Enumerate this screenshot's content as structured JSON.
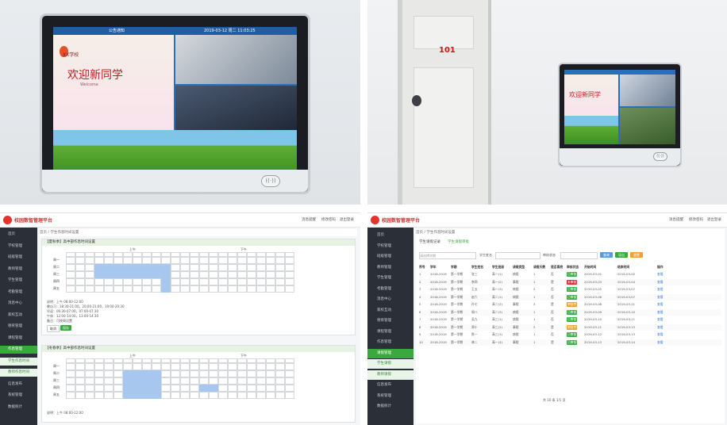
{
  "panel1": {
    "topbar_left": "公告通知",
    "topbar_time": "2019-03-12 周二 11:03:25",
    "greeting_school": "XX学校",
    "greeting_main": "欢迎新同学",
    "greeting_sub": "Welcome",
    "nfc_label": "((·))"
  },
  "panel2": {
    "door_number": "101",
    "screen_title": "欢迎新同学"
  },
  "panel3": {
    "brand": "校园数智管理平台",
    "header_right": [
      "消息提醒",
      "修改密码",
      "退出登录"
    ],
    "breadcrumb": "首页 / 学生作息时间设置",
    "card1_title": "【夏秋季】高中部作息时间设置",
    "card2_title": "【冬春季】高中部作息时间设置",
    "section_am": "上午",
    "section_pm": "下午",
    "days": [
      "周一",
      "周二",
      "周三",
      "周四",
      "周五"
    ],
    "save_btn": "保存",
    "cancel_btn": "取消",
    "desc_lines": [
      "说明：上午 08:00-12:00",
      "晚自习：18:30-21:00，20:00-21:00，19:00-20:30",
      "早读：06:30-07:00，07:00-07:30",
      "午休：12:00-14:00，13:00-14:30",
      "备注：可按周设置"
    ],
    "menu": [
      "首页",
      "学校管理",
      "班级管理",
      "教师管理",
      "学生管理",
      "考勤管理",
      "消息中心",
      "家校互动",
      "德育管理",
      "课程管理",
      "作息管理",
      "学生作息时间",
      "教师作息时间",
      "信息发布",
      "系统管理",
      "数据统计"
    ]
  },
  "panel4": {
    "brand": "校园数智管理平台",
    "tabs": [
      "学生请假记录",
      "学生请假审批"
    ],
    "filter_labels": [
      "请选择学期",
      "学生姓名",
      "审核状态"
    ],
    "buttons": [
      "查询",
      "导出",
      "重置"
    ],
    "columns": [
      "序号",
      "学年",
      "学期",
      "学生姓名",
      "学生班级",
      "请假类型",
      "请假天数",
      "是否离校",
      "审核状态",
      "开始时间",
      "结束时间",
      "操作"
    ],
    "rows": [
      [
        "1",
        "2018-2019",
        "第一学期",
        "张三",
        "高一(1)",
        "病假",
        "1",
        "否",
        "已审核",
        "2019-03-01",
        "2019-03-02",
        "查看"
      ],
      [
        "2",
        "2018-2019",
        "第一学期",
        "李四",
        "高一(2)",
        "事假",
        "1",
        "是",
        "未审核",
        "2019-03-03",
        "2019-03-04",
        "查看"
      ],
      [
        "3",
        "2018-2019",
        "第一学期",
        "王五",
        "高一(3)",
        "病假",
        "2",
        "否",
        "已审核",
        "2019-03-05",
        "2019-03-07",
        "查看"
      ],
      [
        "4",
        "2018-2019",
        "第一学期",
        "赵六",
        "高二(1)",
        "病假",
        "1",
        "否",
        "已审核",
        "2019-03-06",
        "2019-03-07",
        "查看"
      ],
      [
        "5",
        "2018-2019",
        "第一学期",
        "孙七",
        "高二(2)",
        "事假",
        "3",
        "是",
        "审核中",
        "2019-03-08",
        "2019-03-11",
        "查看"
      ],
      [
        "6",
        "2018-2019",
        "第一学期",
        "周八",
        "高二(3)",
        "病假",
        "1",
        "否",
        "已审核",
        "2019-03-09",
        "2019-03-10",
        "查看"
      ],
      [
        "7",
        "2018-2019",
        "第一学期",
        "吴九",
        "高三(1)",
        "病假",
        "1",
        "否",
        "已审核",
        "2019-03-10",
        "2019-03-11",
        "查看"
      ],
      [
        "8",
        "2018-2019",
        "第一学期",
        "郑十",
        "高三(2)",
        "事假",
        "2",
        "是",
        "审核中",
        "2019-03-11",
        "2019-03-13",
        "查看"
      ],
      [
        "9",
        "2018-2019",
        "第一学期",
        "陈一",
        "高三(3)",
        "病假",
        "1",
        "否",
        "已审核",
        "2019-03-12",
        "2019-03-13",
        "查看"
      ],
      [
        "10",
        "2018-2019",
        "第一学期",
        "林二",
        "高一(4)",
        "事假",
        "1",
        "是",
        "已审核",
        "2019-03-13",
        "2019-03-14",
        "查看"
      ]
    ],
    "pager": "共 10 条  1/1 页",
    "menu": [
      "首页",
      "学校管理",
      "班级管理",
      "教师管理",
      "学生管理",
      "考勤管理",
      "消息中心",
      "家校互动",
      "德育管理",
      "课程管理",
      "作息管理",
      "请假管理",
      "学生请假",
      "教师请假",
      "信息发布",
      "系统管理",
      "数据统计"
    ]
  },
  "colors": {
    "green": "#39a93d",
    "red": "#d62f2f",
    "blue": "#a7c7ee",
    "dark": "#2b2f38"
  }
}
